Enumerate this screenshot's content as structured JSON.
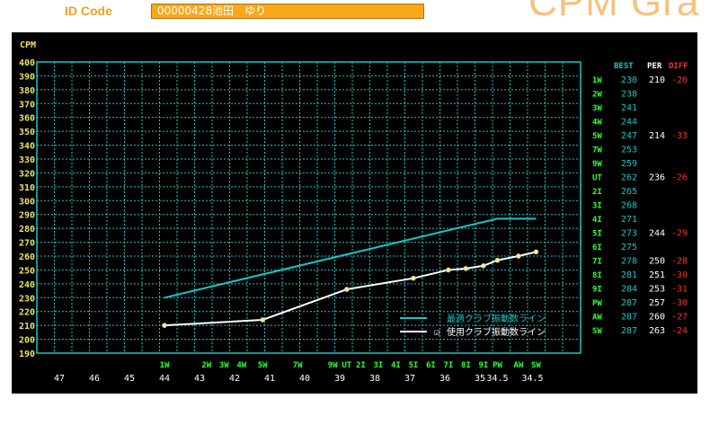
{
  "header": {
    "id_label": "ID Code",
    "id_value": "00000428池田　ゆり",
    "app_title": "CPM Gra"
  },
  "colors": {
    "panel_bg": "#000000",
    "grid": "#14c8c8",
    "ideal_line": "#14c8c8",
    "actual_line": "#ffffff",
    "point": "#f4e8a0",
    "y_labels": "#f0e060",
    "club_labels": "#30ff30",
    "length_labels": "#ffffff",
    "diff": "#ff2a2a",
    "best_header": "#14c8c8"
  },
  "chart_data": {
    "type": "line",
    "ylabel": "CPM",
    "ylim": [
      190,
      400
    ],
    "y_ticks": [
      400,
      390,
      380,
      370,
      360,
      350,
      340,
      330,
      320,
      310,
      300,
      290,
      280,
      270,
      260,
      250,
      240,
      230,
      220,
      210,
      200,
      190
    ],
    "grid": true,
    "x_lengths": [
      "47",
      "46",
      "45",
      "44",
      "43",
      "42",
      "41",
      "40",
      "39",
      "38",
      "37",
      "36",
      "35",
      "34.5",
      "34.5"
    ],
    "x_length_pos": [
      47,
      46,
      45,
      44,
      43,
      42,
      41,
      40,
      39,
      38,
      37,
      36,
      35,
      34.5,
      33.5
    ],
    "clubs": [
      {
        "label": "1W",
        "length": 44
      },
      {
        "label": "2W",
        "length": 42.8
      },
      {
        "label": "3W",
        "length": 42.3
      },
      {
        "label": "4W",
        "length": 41.8
      },
      {
        "label": "5W",
        "length": 41.2
      },
      {
        "label": "7W",
        "length": 40.2
      },
      {
        "label": "9W",
        "length": 39.2
      },
      {
        "label": "UT",
        "length": 38.8
      },
      {
        "label": "2I",
        "length": 38.4
      },
      {
        "label": "3I",
        "length": 37.9
      },
      {
        "label": "4I",
        "length": 37.4
      },
      {
        "label": "5I",
        "length": 36.9
      },
      {
        "label": "6I",
        "length": 36.4
      },
      {
        "label": "7I",
        "length": 35.9
      },
      {
        "label": "8I",
        "length": 35.4
      },
      {
        "label": "9I",
        "length": 34.9
      },
      {
        "label": "PW",
        "length": 34.5
      },
      {
        "label": "AW",
        "length": 33.9
      },
      {
        "label": "SW",
        "length": 33.4
      }
    ],
    "series": [
      {
        "name": "最適クラブ振動数ライン",
        "points": [
          [
            44,
            230
          ],
          [
            34.5,
            287
          ],
          [
            33.4,
            287
          ]
        ]
      },
      {
        "name": "使用クラブ振動数ライン",
        "points": [
          [
            44,
            210
          ],
          [
            41.2,
            214
          ],
          [
            38.8,
            236
          ],
          [
            36.9,
            244
          ],
          [
            35.9,
            250
          ],
          [
            35.4,
            251
          ],
          [
            34.9,
            253
          ],
          [
            34.5,
            257
          ],
          [
            33.9,
            260
          ],
          [
            33.4,
            263
          ]
        ]
      }
    ],
    "legend": {
      "position": "bottom-right",
      "checkbox": "☑"
    },
    "table": {
      "headers": {
        "best": "BEST",
        "per": "PER",
        "diff": "DIFF"
      },
      "rows": [
        {
          "club": "1W",
          "best": "230",
          "per": "210",
          "diff": "-20"
        },
        {
          "club": "2W",
          "best": "238",
          "per": "",
          "diff": ""
        },
        {
          "club": "3W",
          "best": "241",
          "per": "",
          "diff": ""
        },
        {
          "club": "4W",
          "best": "244",
          "per": "",
          "diff": ""
        },
        {
          "club": "5W",
          "best": "247",
          "per": "214",
          "diff": "-33"
        },
        {
          "club": "7W",
          "best": "253",
          "per": "",
          "diff": ""
        },
        {
          "club": "9W",
          "best": "259",
          "per": "",
          "diff": ""
        },
        {
          "club": "UT",
          "best": "262",
          "per": "236",
          "diff": "-26"
        },
        {
          "club": "2I",
          "best": "265",
          "per": "",
          "diff": ""
        },
        {
          "club": "3I",
          "best": "268",
          "per": "",
          "diff": ""
        },
        {
          "club": "4I",
          "best": "271",
          "per": "",
          "diff": ""
        },
        {
          "club": "5I",
          "best": "273",
          "per": "244",
          "diff": "-29"
        },
        {
          "club": "6I",
          "best": "275",
          "per": "",
          "diff": ""
        },
        {
          "club": "7I",
          "best": "278",
          "per": "250",
          "diff": "-28"
        },
        {
          "club": "8I",
          "best": "281",
          "per": "251",
          "diff": "-30"
        },
        {
          "club": "9I",
          "best": "284",
          "per": "253",
          "diff": "-31"
        },
        {
          "club": "PW",
          "best": "287",
          "per": "257",
          "diff": "-30"
        },
        {
          "club": "AW",
          "best": "287",
          "per": "260",
          "diff": "-27"
        },
        {
          "club": "SW",
          "best": "287",
          "per": "263",
          "diff": "-24"
        }
      ]
    }
  }
}
